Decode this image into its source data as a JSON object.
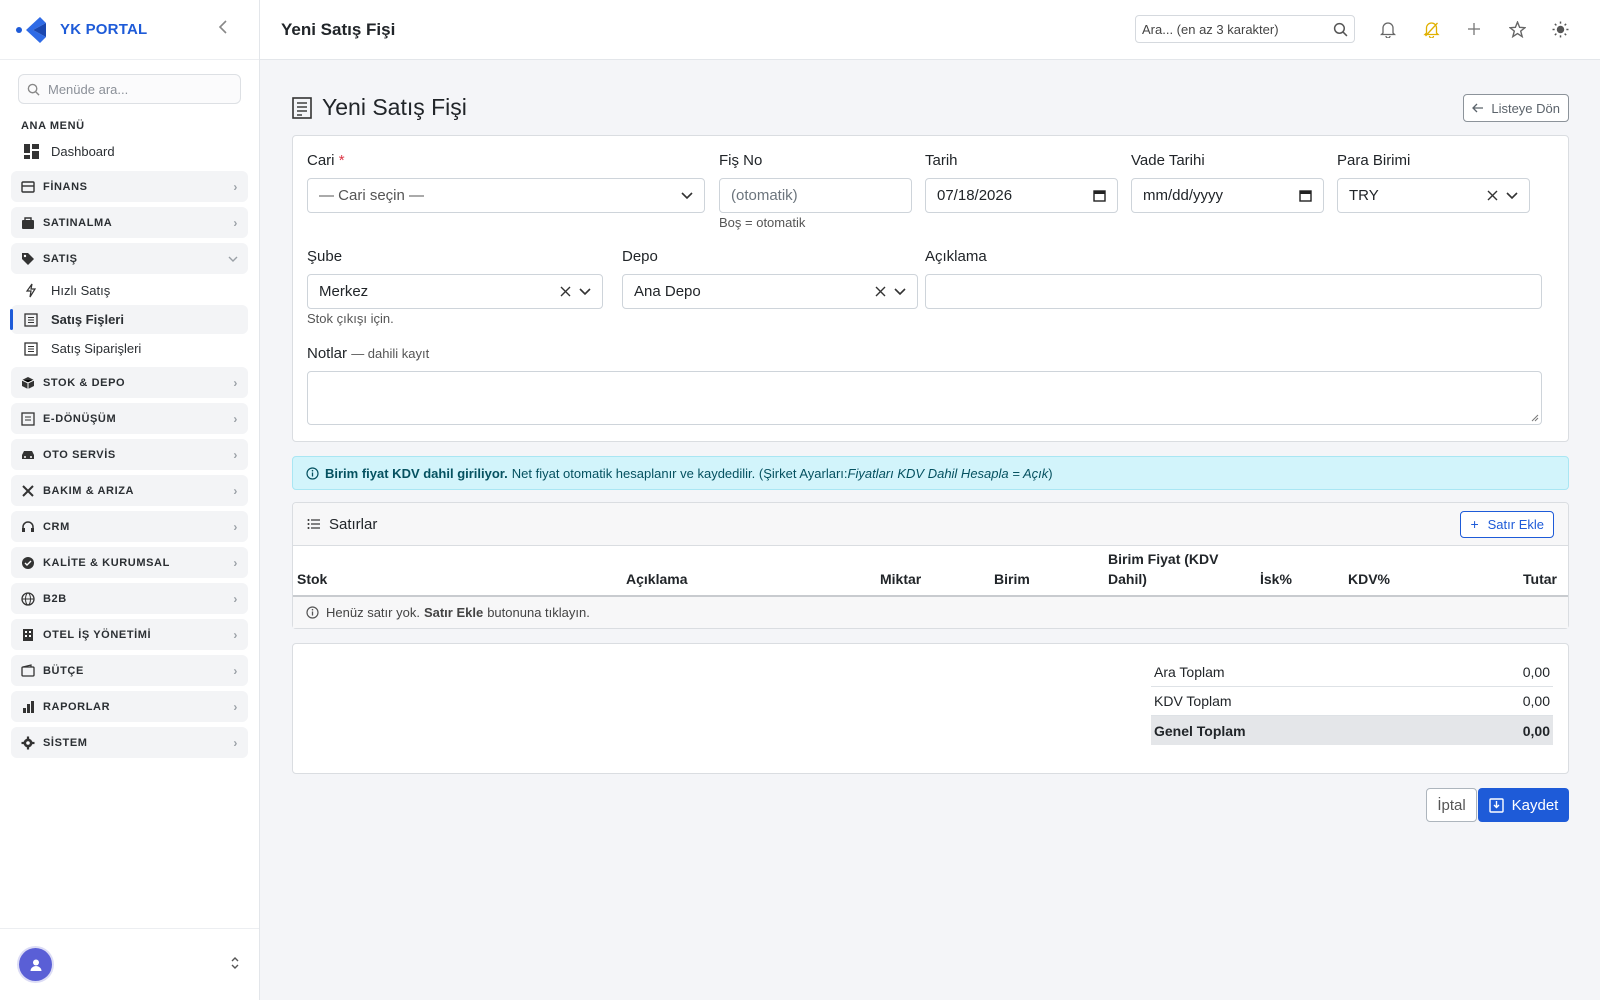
{
  "brand": {
    "name": "YK PORTAL"
  },
  "sidebar": {
    "search_placeholder": "Menüde ara...",
    "section_title": "ANA MENÜ",
    "dashboard_label": "Dashboard",
    "groups": [
      {
        "label": "FİNANS",
        "icon": "finance-icon"
      },
      {
        "label": "SATINALMA",
        "icon": "bag-icon"
      },
      {
        "label": "SATIŞ",
        "icon": "tag-icon",
        "expanded": true
      }
    ],
    "sales_items": [
      {
        "label": "Hızlı Satış",
        "icon": "lightning-icon"
      },
      {
        "label": "Satış Fişleri",
        "icon": "receipt-icon",
        "active": true
      },
      {
        "label": "Satış Siparişleri",
        "icon": "receipt-icon"
      }
    ],
    "groups_after": [
      {
        "label": "STOK & DEPO",
        "icon": "box-icon"
      },
      {
        "label": "E-DÖNÜŞÜM",
        "icon": "document-icon"
      },
      {
        "label": "OTO SERVİS",
        "icon": "car-icon"
      },
      {
        "label": "BAKIM & ARIZA",
        "icon": "tools-icon"
      },
      {
        "label": "CRM",
        "icon": "headset-icon"
      },
      {
        "label": "KALİTE & KURUMSAL",
        "icon": "badge-check-icon"
      },
      {
        "label": "B2B",
        "icon": "globe-icon"
      },
      {
        "label": "OTEL İŞ YÖNETİMİ",
        "icon": "building-icon"
      },
      {
        "label": "BÜTÇE",
        "icon": "wallet-icon"
      },
      {
        "label": "RAPORLAR",
        "icon": "bar-chart-icon"
      },
      {
        "label": "SİSTEM",
        "icon": "gear-icon"
      }
    ]
  },
  "topbar": {
    "title": "Yeni Satış Fişi",
    "search_placeholder": "Ara... (en az 3 karakter)"
  },
  "page": {
    "title": "Yeni Satış Fişi",
    "back_label": "Listeye Dön"
  },
  "form": {
    "cari": {
      "label": "Cari",
      "required_mark": "*",
      "value": "— Cari seçin —"
    },
    "fis_no": {
      "label": "Fiş No",
      "placeholder": "(otomatik)",
      "help": "Boş = otomatik"
    },
    "tarih": {
      "label": "Tarih",
      "value": "07/18/2026"
    },
    "vade_tarihi": {
      "label": "Vade Tarihi",
      "value": "mm/dd/yyyy"
    },
    "para_birimi": {
      "label": "Para Birimi",
      "value": "TRY"
    },
    "sube": {
      "label": "Şube",
      "value": "Merkez",
      "help": "Stok çıkışı için."
    },
    "depo": {
      "label": "Depo",
      "value": "Ana Depo"
    },
    "aciklama": {
      "label": "Açıklama",
      "value": ""
    },
    "notlar": {
      "label": "Notlar",
      "sub": "— dahili kayıt",
      "value": ""
    }
  },
  "alert": {
    "bold": "Birim fiyat KDV dahil giriliyor.",
    "text": "Net fiyat otomatik hesaplanır ve kaydedilir. (Şirket Ayarları: ",
    "italic": "Fiyatları KDV Dahil Hesapla = Açık",
    "end": ")"
  },
  "lines": {
    "title": "Satırlar",
    "add_label": "Satır Ekle",
    "columns": [
      "Stok",
      "Açıklama",
      "Miktar",
      "Birim",
      "Birim Fiyat (KDV Dahil)",
      "İsk%",
      "KDV%",
      "Tutar"
    ],
    "empty": {
      "pre": "Henüz satır yok.",
      "bold": "Satır Ekle",
      "post": "butonuna tıklayın."
    }
  },
  "totals": {
    "ara_label": "Ara Toplam",
    "ara_value": "0,00",
    "kdv_label": "KDV Toplam",
    "kdv_value": "0,00",
    "genel_label": "Genel Toplam",
    "genel_value": "0,00"
  },
  "actions": {
    "cancel_label": "İptal",
    "save_label": "Kaydet"
  },
  "colors": {
    "primary": "#1e5bd8",
    "info_bg": "#d2f4fb",
    "danger": "#dc3545",
    "avatar": "#5a5fd6"
  }
}
